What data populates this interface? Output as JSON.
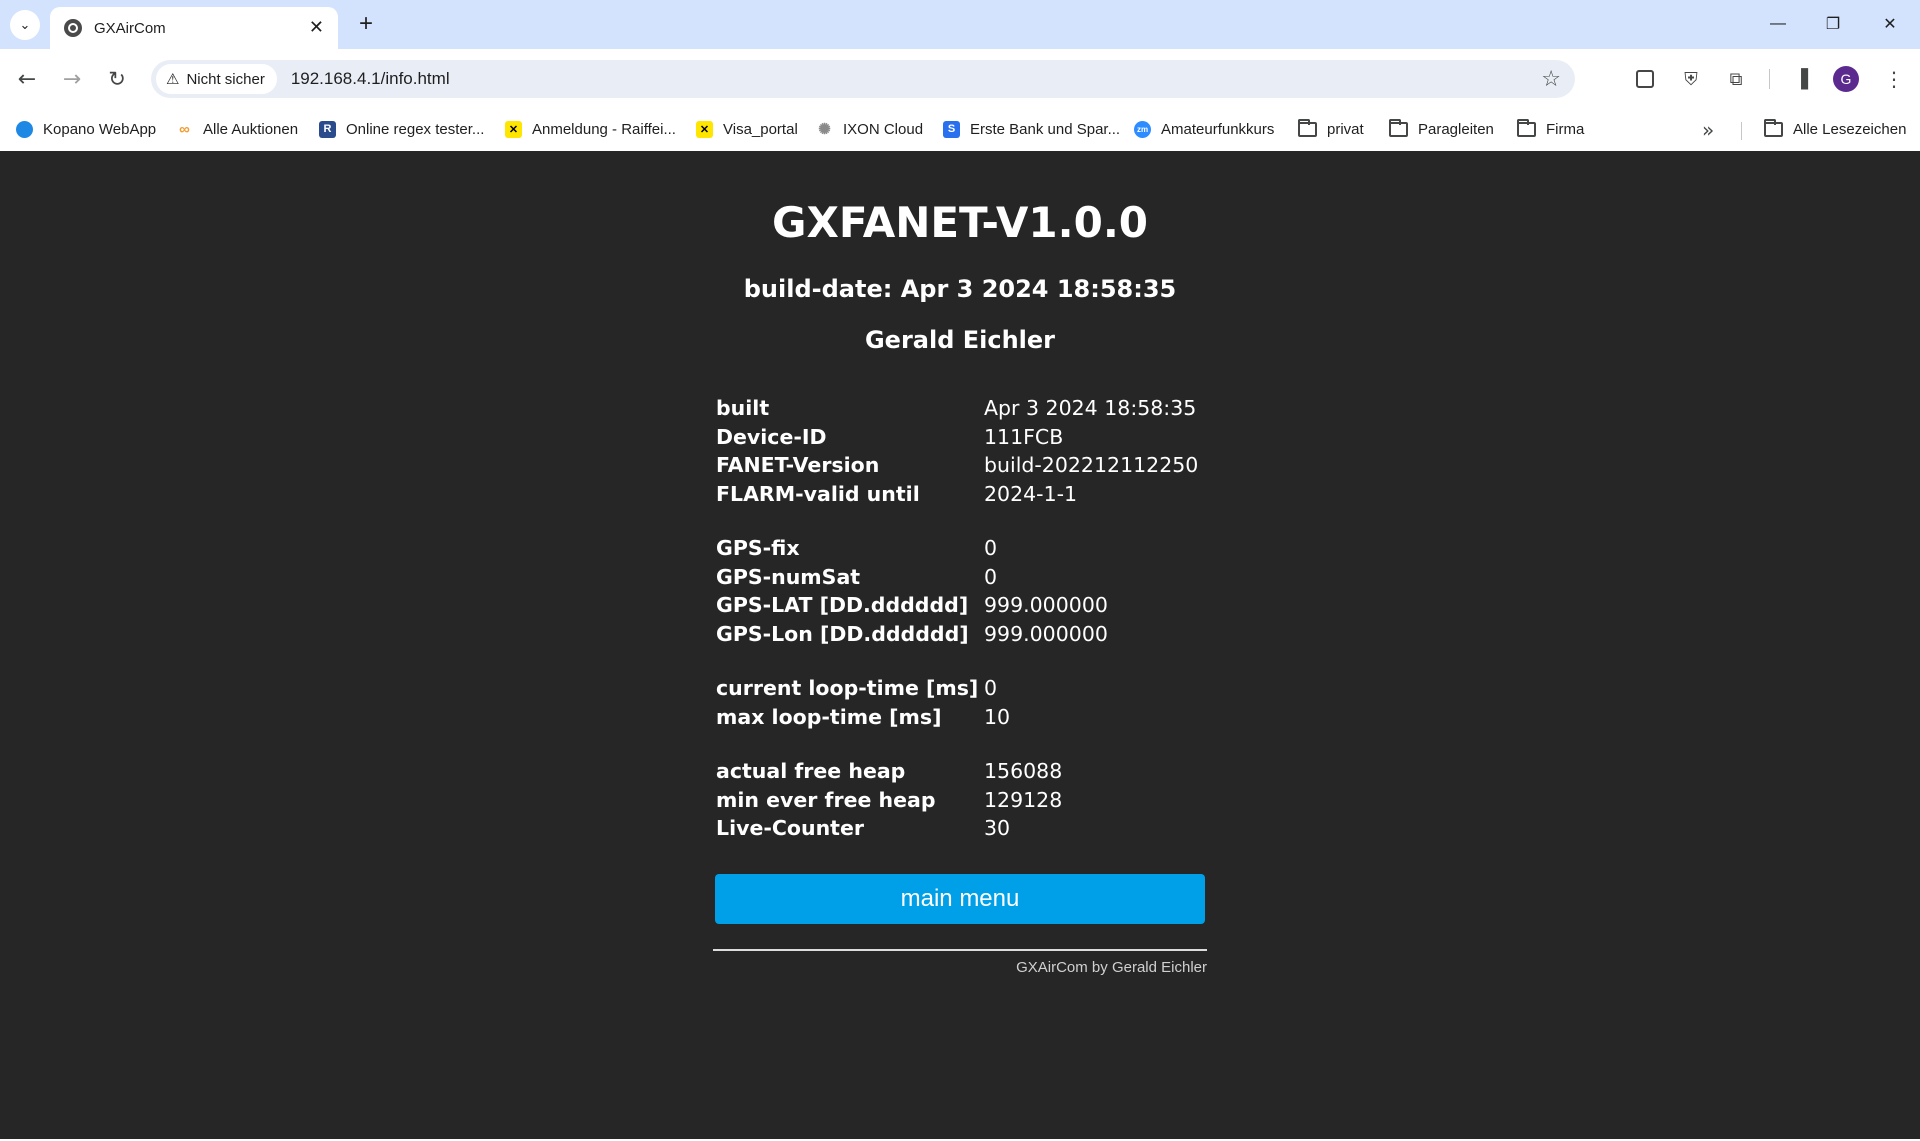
{
  "browser": {
    "tab": {
      "title": "GXAirCom",
      "close": "✕"
    },
    "new_tab": "+",
    "window_controls": {
      "minimize": "—",
      "restore": "❐",
      "close": "✕"
    },
    "security_chip": "Nicht sicher",
    "url": "192.168.4.1/info.html",
    "profile_initial": "G",
    "bookmarks": [
      {
        "label": "Kopano WebApp",
        "icon": "kopano-icon",
        "color": "#1e88e5"
      },
      {
        "label": "Alle Auktionen",
        "icon": "infinity-icon",
        "color": "#f29b2e"
      },
      {
        "label": "Online regex tester...",
        "icon": "regex-r-icon",
        "color": "#2b4c8c"
      },
      {
        "label": "Anmeldung - Raiffei...",
        "icon": "raiffeisen-icon",
        "color": "#ffe600"
      },
      {
        "label": "Visa_portal",
        "icon": "raiffeisen-icon",
        "color": "#ffe600"
      },
      {
        "label": "IXON Cloud",
        "icon": "ixon-icon",
        "color": "#8a8a8a"
      },
      {
        "label": "Erste Bank und Spar...",
        "icon": "erste-icon",
        "color": "#2870ed"
      },
      {
        "label": "Amateurfunkkurs",
        "icon": "zoom-icon",
        "color": "#2d8cff"
      },
      {
        "label": "privat",
        "icon": "folder-icon"
      },
      {
        "label": "Paragleiten",
        "icon": "folder-icon"
      },
      {
        "label": "Firma",
        "icon": "folder-icon"
      }
    ],
    "all_bookmarks": "Alle Lesezeichen"
  },
  "page": {
    "title": "GXFANET-V1.0.0",
    "build_date": "build-date: Apr 3 2024 18:58:35",
    "author": "Gerald Eichler",
    "groups": [
      [
        {
          "key": "built",
          "value": "Apr 3 2024 18:58:35"
        },
        {
          "key": "Device-ID",
          "value": "111FCB"
        },
        {
          "key": "FANET-Version",
          "value": "build-202212112250"
        },
        {
          "key": "FLARM-valid until",
          "value": "2024-1-1"
        }
      ],
      [
        {
          "key": "GPS-fix",
          "value": "0"
        },
        {
          "key": "GPS-numSat",
          "value": "0"
        },
        {
          "key": "GPS-LAT [DD.dddddd]",
          "value": "999.000000"
        },
        {
          "key": "GPS-Lon [DD.dddddd]",
          "value": "999.000000"
        }
      ],
      [
        {
          "key": "current loop-time [ms]",
          "value": "0"
        },
        {
          "key": "max loop-time [ms]",
          "value": "10"
        }
      ],
      [
        {
          "key": "actual free heap",
          "value": "156088"
        },
        {
          "key": "min ever free heap",
          "value": "129128"
        },
        {
          "key": "Live-Counter",
          "value": "30"
        }
      ]
    ],
    "main_menu_label": "main menu",
    "footer": "GXAirCom by Gerald Eichler"
  },
  "colors": {
    "page_background": "#262626",
    "button": "#00a0e8",
    "tab_strip": "#d3e3fd"
  }
}
